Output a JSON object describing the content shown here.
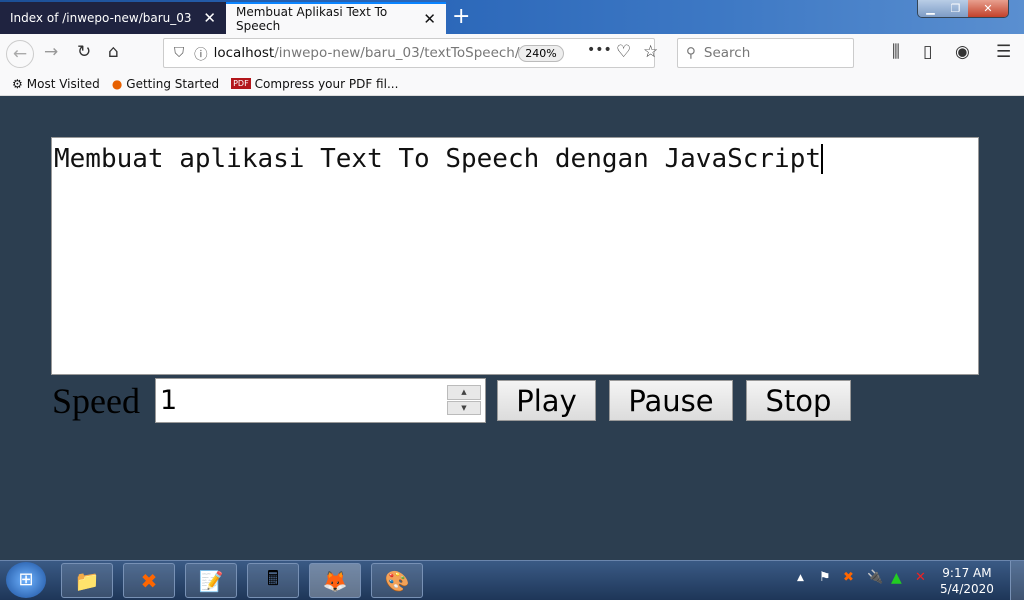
{
  "browser": {
    "tabs": [
      {
        "label": "Index of /inwepo-new/baru_03",
        "active": false
      },
      {
        "label": "Membuat Aplikasi Text To Speech",
        "active": true
      }
    ],
    "url_host": "localhost",
    "url_path": "/inwepo-new/baru_03/textToSpeech/",
    "zoom": "240%",
    "search_placeholder": "Search",
    "bookmarks": [
      {
        "label": "Most Visited",
        "icon": "gear-icon"
      },
      {
        "label": "Getting Started",
        "icon": "firefox-icon"
      },
      {
        "label": "Compress your PDF fil...",
        "icon": "pdf-icon"
      }
    ]
  },
  "page": {
    "text": "Membuat aplikasi Text To Speech dengan JavaScript",
    "speed_label": "Speed",
    "speed_value": "1",
    "buttons": {
      "play": "Play",
      "pause": "Pause",
      "stop": "Stop"
    }
  },
  "taskbar": {
    "time": "9:17 AM",
    "date": "5/4/2020"
  }
}
